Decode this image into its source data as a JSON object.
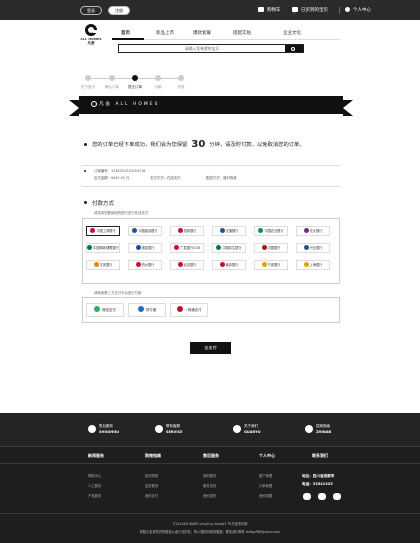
{
  "topbar": {
    "login": "登录",
    "register": "注册",
    "cart": "购物车",
    "bought": "已买到的宝贝",
    "account": "个人中心"
  },
  "logo": {
    "en": "ALL HOMES",
    "cn": "凡舍"
  },
  "nav": [
    "首页",
    "新品上市",
    "爆款套餐",
    "搭配实拍",
    "企业文化"
  ],
  "search": {
    "placeholder": "请输入您希望的宝贝"
  },
  "steps": [
    "拍下宝贝",
    "确认订单",
    "提交订单",
    "付款",
    "完成"
  ],
  "ribbon": {
    "brand": "凡舍",
    "text": "ALL HOMES"
  },
  "notice": {
    "before": "您的订单已经下单成功，我们会为您保留",
    "minutes": "30",
    "after": "分钟，请及时付款，以免取消您的订单。"
  },
  "order": {
    "number_label": "订单编号：",
    "number": "1236251010254716",
    "amount_label": "应付金额：",
    "amount": "¥455.00 元",
    "method_label": "支付方式：",
    "method": "在线支付",
    "delivery_label": "配送方式：",
    "delivery": "普利快递"
  },
  "payment": {
    "title": "付款方式",
    "bank_hint": "请选择您要使用的银行进行在线支付",
    "banks": [
      {
        "name": "中国工商银行",
        "color": "#c8102e"
      },
      {
        "name": "中国建设银行",
        "color": "#1f4e9a"
      },
      {
        "name": "招商银行",
        "color": "#c8102e"
      },
      {
        "name": "交通银行",
        "color": "#1f4e9a"
      },
      {
        "name": "中国农业银行",
        "color": "#0a8a6a"
      },
      {
        "name": "光大银行",
        "color": "#6a2c91"
      },
      {
        "name": "中国邮政储蓄银行",
        "color": "#007a3d"
      },
      {
        "name": "浦发银行",
        "color": "#1f4e9a"
      },
      {
        "name": "广发银行CGB",
        "color": "#c8102e"
      },
      {
        "name": "中国民生银行",
        "color": "#0a7a4a"
      },
      {
        "name": "中国银行",
        "color": "#b5121b"
      },
      {
        "name": "兴业银行",
        "color": "#1f4e9a"
      },
      {
        "name": "平安银行",
        "color": "#f08300"
      },
      {
        "name": "杭州银行",
        "color": "#c8102e"
      },
      {
        "name": "北京银行",
        "color": "#c8102e"
      },
      {
        "name": "南京银行",
        "color": "#c8102e"
      },
      {
        "name": "宁波银行",
        "color": "#e0a000"
      },
      {
        "name": "上海银行",
        "color": "#e0a000"
      }
    ],
    "third_hint": "请使用第三方支付平台进行付款",
    "third": [
      {
        "name": "微信支付",
        "color": "#2aae67"
      },
      {
        "name": "财付通",
        "color": "#1f6fc5"
      },
      {
        "name": "一网通支付",
        "color": "#c8102e"
      }
    ],
    "button": "去支付"
  },
  "footer": {
    "services": [
      {
        "cn": "售后服务",
        "en": "SHOUHOU"
      },
      {
        "cn": "联系客服",
        "en": "SERVICE"
      },
      {
        "cn": "关于我们",
        "en": "GUANYU"
      },
      {
        "cn": "招商指南",
        "en": "ZHINAN"
      }
    ],
    "columns": [
      {
        "title": "新闻服务",
        "items": [
          "帮助中心",
          "人工服务",
          "产品服务"
        ]
      },
      {
        "title": "购物指南",
        "items": [
          "如何购物",
          "送货服务",
          "我的支付"
        ]
      },
      {
        "title": "售后服务",
        "items": [
          "我的服务",
          "服务支持",
          "我的退货"
        ]
      },
      {
        "title": "个人中心",
        "items": [
          "账户管理",
          "订单管理",
          "我的收藏"
        ]
      },
      {
        "title": "联系我们",
        "items": [
          "地址：四川省成都市",
          "电话：33541325"
        ]
      }
    ],
    "copyright": "©LELAXA WARD.ymoji by eyeag3 TR凡舍事件部",
    "copyright2": "商配元素将知识所被是从者行业的状，所以通知向我暂客服，联系我们邮件 zbftgzff@fgngnw.com"
  }
}
